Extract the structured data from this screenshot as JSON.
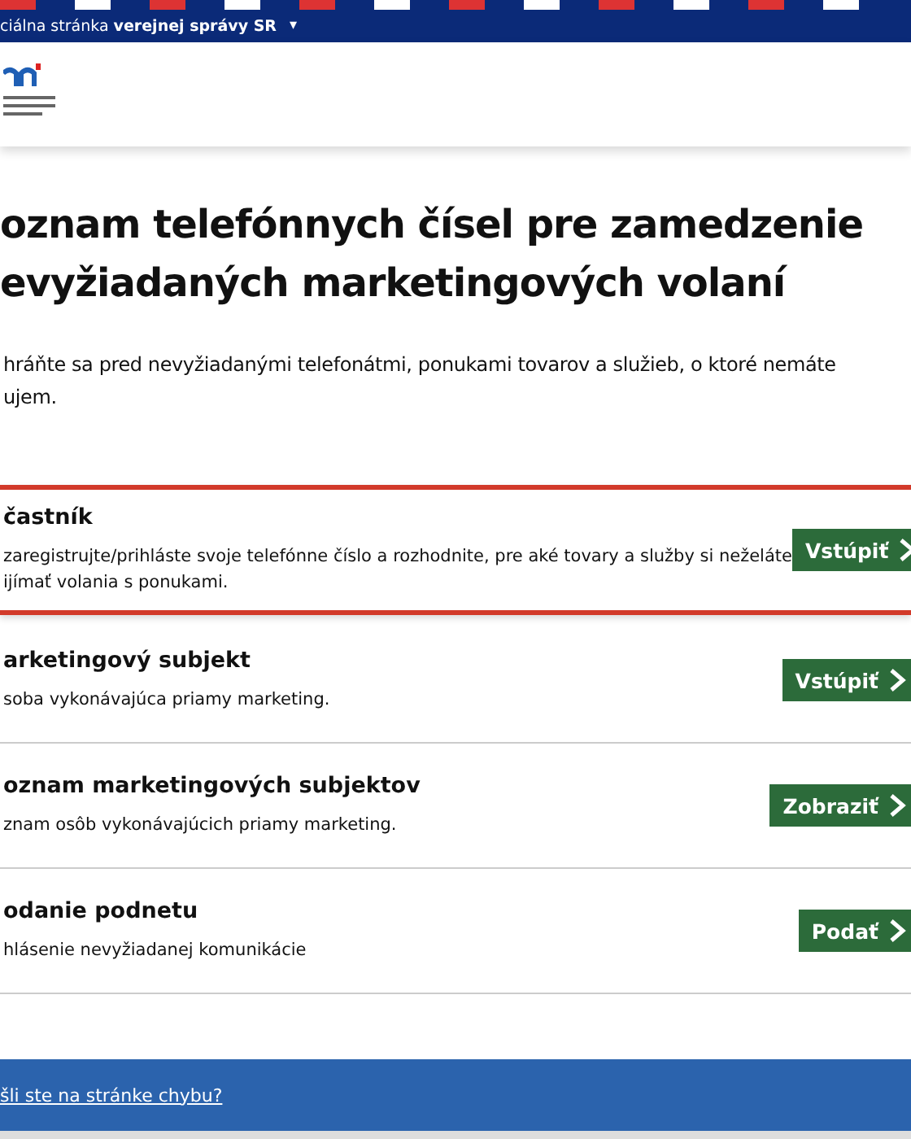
{
  "top_bar": {
    "text": "ciálna stránka **verejnej správy SR**",
    "caret": "▾"
  },
  "heading_lines": [
    "oznam telefónnych čísel pre zamedzenie",
    "evyžiadaných marketingových volaní"
  ],
  "intro_lines": [
    "hráňte sa pred nevyžiadanými telefonátmi, ponukami tovarov a služieb, o ktoré nemáte",
    "ujem."
  ],
  "cards": [
    {
      "title": "častník",
      "description_lines": [
        "zaregistrujte/prihláste svoje telefónne číslo a rozhodnite, pre aké tovary a služby si neželáte",
        "ijímať volania s ponukami."
      ],
      "button": "Vstúpiť",
      "highlighted": true
    },
    {
      "title": "arketingový subjekt",
      "description_lines": [
        "soba vykonávajúca priamy marketing."
      ],
      "button": "Vstúpiť",
      "highlighted": false
    },
    {
      "title": "oznam marketingových subjektov",
      "description_lines": [
        "znam osôb vykonávajúcich priamy marketing."
      ],
      "button": "Zobraziť",
      "highlighted": false
    },
    {
      "title": "odanie podnetu",
      "description_lines": [
        "hlásenie nevyžiadanej komunikácie"
      ],
      "button": "Podať",
      "highlighted": false
    }
  ],
  "footer": {
    "link": "šli ste na stránke chybu?"
  }
}
